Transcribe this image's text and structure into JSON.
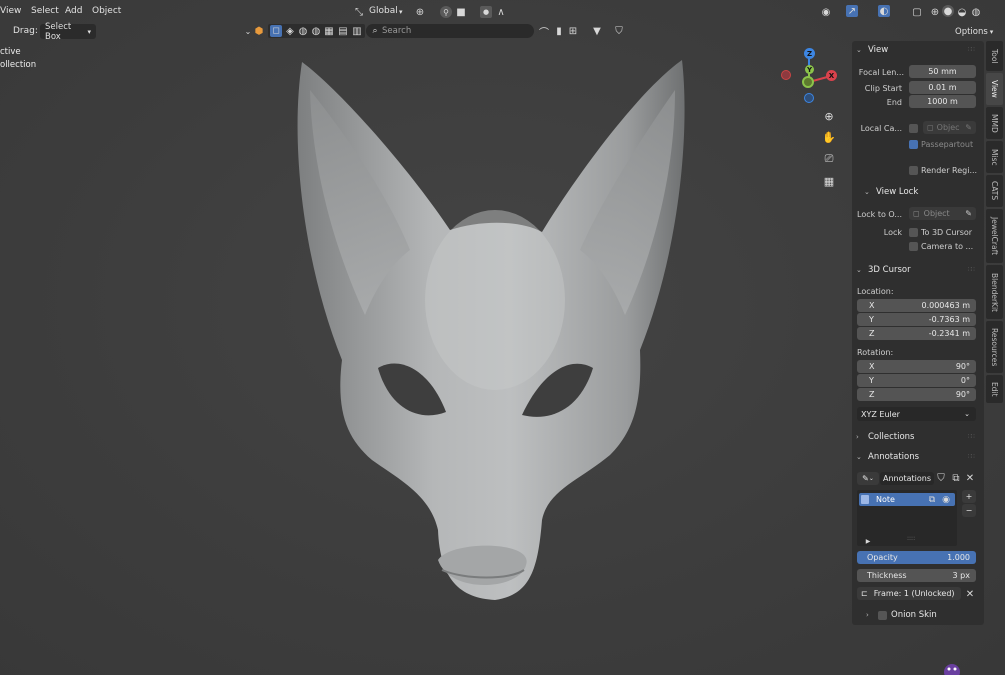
{
  "menu": {
    "view": "View",
    "select": "Select",
    "add": "Add",
    "object": "Object"
  },
  "header": {
    "drag_label": "Drag:",
    "drag_value": "Select Box",
    "transform_orientation": "Global",
    "search_placeholder": "Search",
    "options": "Options"
  },
  "overlay": {
    "mode_line": "ctive",
    "collection_line": "ollection"
  },
  "gizmo": {
    "z": "Z",
    "y": "Y",
    "x": "X"
  },
  "tabs": [
    "Tool",
    "View",
    "MMD",
    "Misc",
    "CATS",
    "JewelCraft",
    "BlenderKit",
    "Resources",
    "Edit"
  ],
  "view_panel": {
    "title": "View",
    "focal_label": "Focal Len...",
    "focal_value": "50 mm",
    "clip_start_label": "Clip Start",
    "clip_start_value": "0.01 m",
    "clip_end_label": "End",
    "clip_end_value": "1000 m",
    "local_camera_label": "Local Ca...",
    "local_camera_value": "Objec",
    "passepartout": "Passepartout",
    "render_region": "Render Regi..."
  },
  "view_lock": {
    "title": "View Lock",
    "lock_to_label": "Lock to O...",
    "lock_to_value": "Object",
    "lock_label": "Lock",
    "to_cursor": "To 3D Cursor",
    "camera_to": "Camera to ..."
  },
  "cursor": {
    "title": "3D Cursor",
    "location_label": "Location:",
    "loc_x_label": "X",
    "loc_x": "0.000463 m",
    "loc_y_label": "Y",
    "loc_y": "-0.7363 m",
    "loc_z_label": "Z",
    "loc_z": "-0.2341 m",
    "rotation_label": "Rotation:",
    "rot_x_label": "X",
    "rot_x": "90°",
    "rot_y_label": "Y",
    "rot_y": "0°",
    "rot_z_label": "Z",
    "rot_z": "90°",
    "rotation_mode": "XYZ Euler"
  },
  "collections": {
    "title": "Collections"
  },
  "annotations": {
    "title": "Annotations",
    "datablock": "Annotations",
    "layer_name": "Note",
    "opacity_label": "Opacity",
    "opacity_value": "1.000",
    "thickness_label": "Thickness",
    "thickness_value": "3 px",
    "frame": "Frame: 1 (Unlocked)",
    "onion_skin": "Onion Skin"
  },
  "colors": {
    "accent": "#4772b3",
    "x_axis": "#d9424c",
    "y_axis": "#8bc34a",
    "z_axis": "#3d86e3",
    "panel": "#2f2f2f",
    "field": "#545454"
  }
}
